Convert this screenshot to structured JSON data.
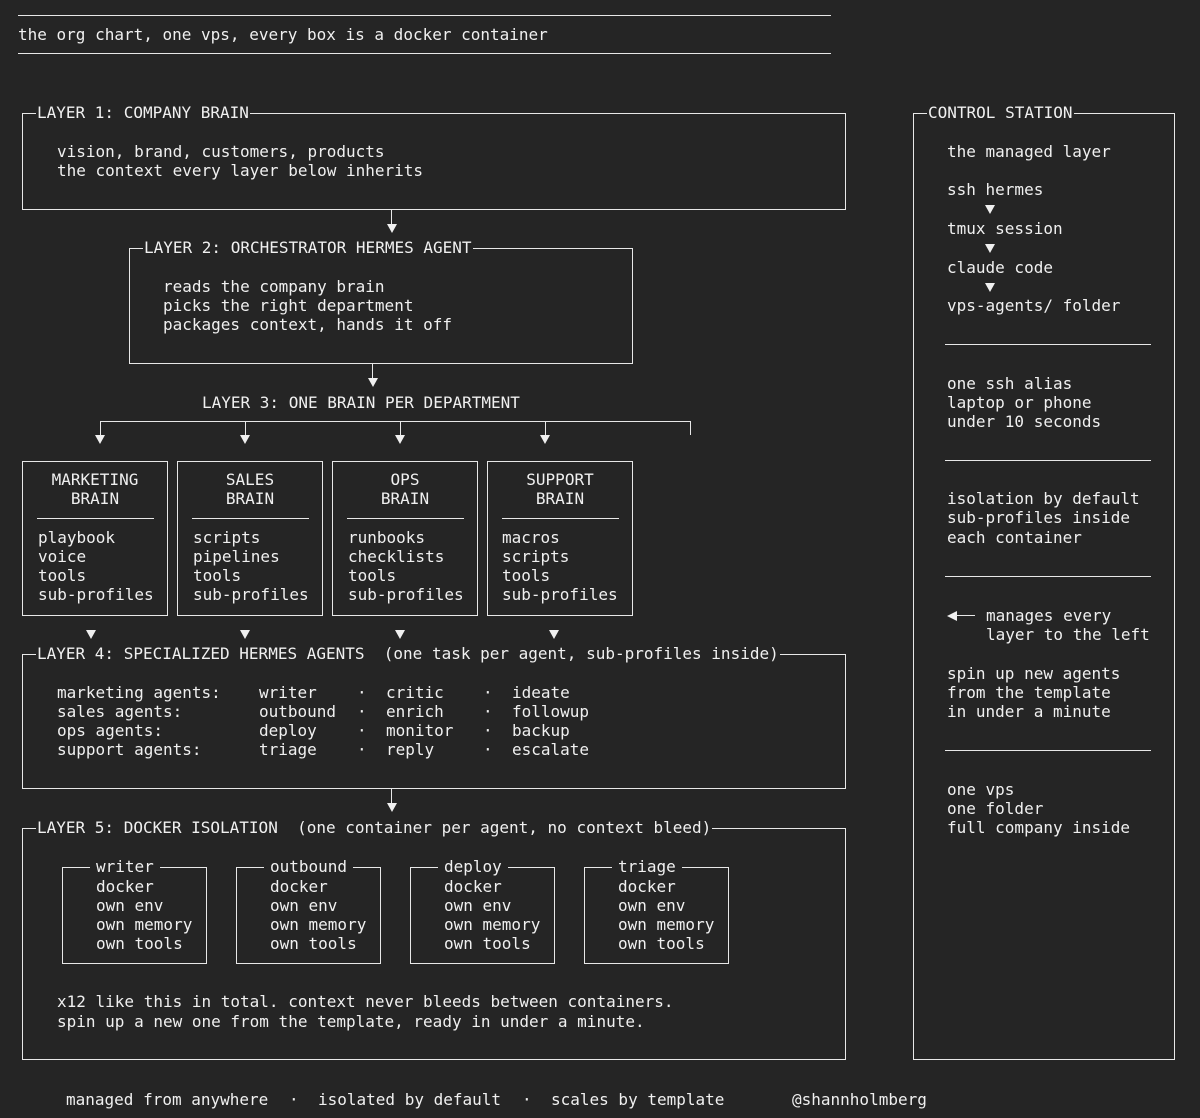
{
  "header": {
    "title": "the org chart, one vps, every box is a docker container"
  },
  "layer1": {
    "label": "LAYER 1: COMPANY BRAIN",
    "lines": [
      "vision, brand, customers, products",
      "the context every layer below inherits"
    ]
  },
  "layer2": {
    "label": "LAYER 2: ORCHESTRATOR HERMES AGENT",
    "lines": [
      "reads the company brain",
      "picks the right department",
      "packages context, hands it off"
    ]
  },
  "layer3": {
    "label": "LAYER 3: ONE BRAIN PER DEPARTMENT",
    "brains": [
      {
        "title1": "MARKETING",
        "title2": "BRAIN",
        "items": [
          "playbook",
          "voice",
          "tools",
          "sub-profiles"
        ]
      },
      {
        "title1": "SALES",
        "title2": "BRAIN",
        "items": [
          "scripts",
          "pipelines",
          "tools",
          "sub-profiles"
        ]
      },
      {
        "title1": "OPS",
        "title2": "BRAIN",
        "items": [
          "runbooks",
          "checklists",
          "tools",
          "sub-profiles"
        ]
      },
      {
        "title1": "SUPPORT",
        "title2": "BRAIN",
        "items": [
          "macros",
          "scripts",
          "tools",
          "sub-profiles"
        ]
      }
    ]
  },
  "layer4": {
    "label": "LAYER 4: SPECIALIZED HERMES AGENTS  (one task per agent, sub-profiles inside)",
    "separator": "·",
    "rows": [
      {
        "dept": "marketing agents:",
        "a": "writer",
        "b": "critic",
        "c": "ideate"
      },
      {
        "dept": "sales agents:",
        "a": "outbound",
        "b": "enrich",
        "c": "followup"
      },
      {
        "dept": "ops agents:",
        "a": "deploy",
        "b": "monitor",
        "c": "backup"
      },
      {
        "dept": "support agents:",
        "a": "triage",
        "b": "reply",
        "c": "escalate"
      }
    ]
  },
  "layer5": {
    "label": "LAYER 5: DOCKER ISOLATION  (one container per agent, no context bleed)",
    "containers": [
      {
        "name": "writer",
        "lines": [
          "docker",
          "own env",
          "own memory",
          "own tools"
        ]
      },
      {
        "name": "outbound",
        "lines": [
          "docker",
          "own env",
          "own memory",
          "own tools"
        ]
      },
      {
        "name": "deploy",
        "lines": [
          "docker",
          "own env",
          "own memory",
          "own tools"
        ]
      },
      {
        "name": "triage",
        "lines": [
          "docker",
          "own env",
          "own memory",
          "own tools"
        ]
      }
    ],
    "footer": [
      "x12 like this in total. context never bleeds between containers.",
      "spin up a new one from the template, ready in under a minute."
    ]
  },
  "control": {
    "label": "CONTROL STATION",
    "managed": "the managed layer",
    "chain": [
      "ssh hermes",
      "tmux session",
      "claude code",
      "vps-agents/ folder"
    ],
    "alias": [
      "one ssh alias",
      "laptop or phone",
      "under 10 seconds"
    ],
    "isolation": [
      "isolation by default",
      "sub-profiles inside",
      "each container"
    ],
    "manages": [
      "manages every",
      "layer to the left"
    ],
    "spin": [
      "spin up new agents",
      "from the template",
      "in under a minute"
    ],
    "vps": [
      "one vps",
      "one folder",
      "full company inside"
    ]
  },
  "footer": {
    "items": [
      "managed from anywhere",
      "isolated by default",
      "scales by template"
    ],
    "separator": "·",
    "handle": "@shannholmberg"
  }
}
